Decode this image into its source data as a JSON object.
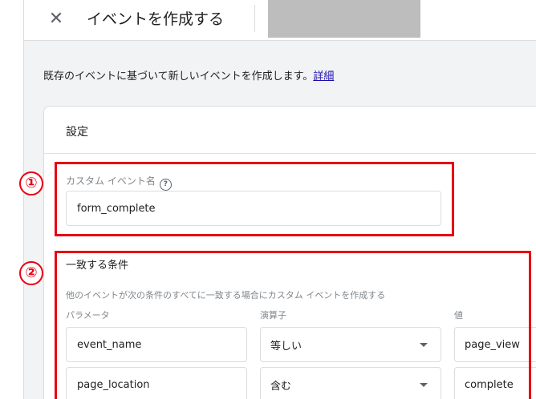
{
  "header": {
    "title": "イベントを作成する",
    "close_icon": "close-icon"
  },
  "description": {
    "text": "既存のイベントに基づいて新しいイベントを作成します。",
    "link": "詳細"
  },
  "card": {
    "title": "設定",
    "custom_event": {
      "label": "カスタム イベント名",
      "help_icon_glyph": "?",
      "value": "form_complete"
    },
    "conditions": {
      "title": "一致する条件",
      "description": "他のイベントが次の条件のすべてに一致する場合にカスタム イベントを作成する",
      "columns": {
        "parameter": "パラメータ",
        "operator": "演算子",
        "value": "値"
      },
      "rows": [
        {
          "parameter": "event_name",
          "operator": "等しい",
          "value": "page_view"
        },
        {
          "parameter": "page_location",
          "operator": "含む",
          "value": "complete"
        }
      ]
    }
  },
  "annotations": {
    "badge_1": "①",
    "badge_2": "②",
    "color": "#e60012"
  }
}
